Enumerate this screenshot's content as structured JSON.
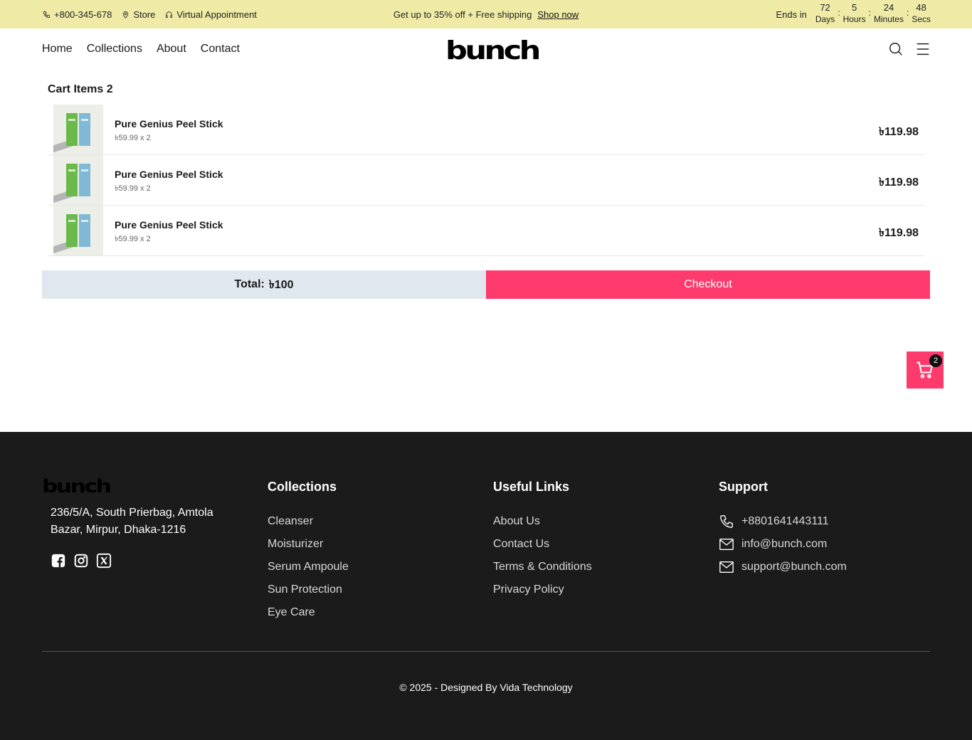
{
  "topbar": {
    "phone": "+800-345-678",
    "store": "Store",
    "appointment": "Virtual Appointment",
    "promo": "Get up to 35% off + Free shipping",
    "shop_now": "Shop now",
    "ends_in": "Ends in",
    "countdown": [
      {
        "value": "72",
        "unit": "Days"
      },
      {
        "value": "5",
        "unit": "Hours"
      },
      {
        "value": "24",
        "unit": "Minutes"
      },
      {
        "value": "48",
        "unit": "Secs"
      }
    ]
  },
  "header": {
    "nav": [
      "Home",
      "Collections",
      "About",
      "Contact"
    ],
    "logo": "bunch"
  },
  "cart": {
    "title": "Cart Items 2",
    "items": [
      {
        "name": "Pure Genius Peel Stick",
        "qty_line": "৳59.99 x 2",
        "total": "৳119.98"
      },
      {
        "name": "Pure Genius Peel Stick",
        "qty_line": "৳59.99 x 2",
        "total": "৳119.98"
      },
      {
        "name": "Pure Genius Peel Stick",
        "qty_line": "৳59.99 x 2",
        "total": "৳119.98"
      }
    ],
    "total_label": "Total:",
    "total_value": "৳100",
    "checkout_label": "Checkout",
    "badge_count": "2"
  },
  "footer": {
    "logo": "bunch",
    "address": "236/5/A, South Prierbag, Amtola Bazar, Mirpur, Dhaka-1216",
    "collections_title": "Collections",
    "collections": [
      "Cleanser",
      "Moisturizer",
      "Serum Ampoule",
      "Sun Protection",
      "Eye Care"
    ],
    "links_title": "Useful Links",
    "links": [
      "About Us",
      "Contact Us",
      "Terms & Conditions",
      "Privacy Policy"
    ],
    "support_title": "Support",
    "phone": "+8801641443111",
    "email1": "info@bunch.com",
    "email2": "support@bunch.com",
    "copyright": "© 2025 - Designed By  Vida Technology"
  },
  "colors": {
    "topbar_bg": "#efeba6",
    "accent": "#ff3b6e",
    "total_bg": "#e0e7ef",
    "footer_bg": "#1b1b1b"
  }
}
